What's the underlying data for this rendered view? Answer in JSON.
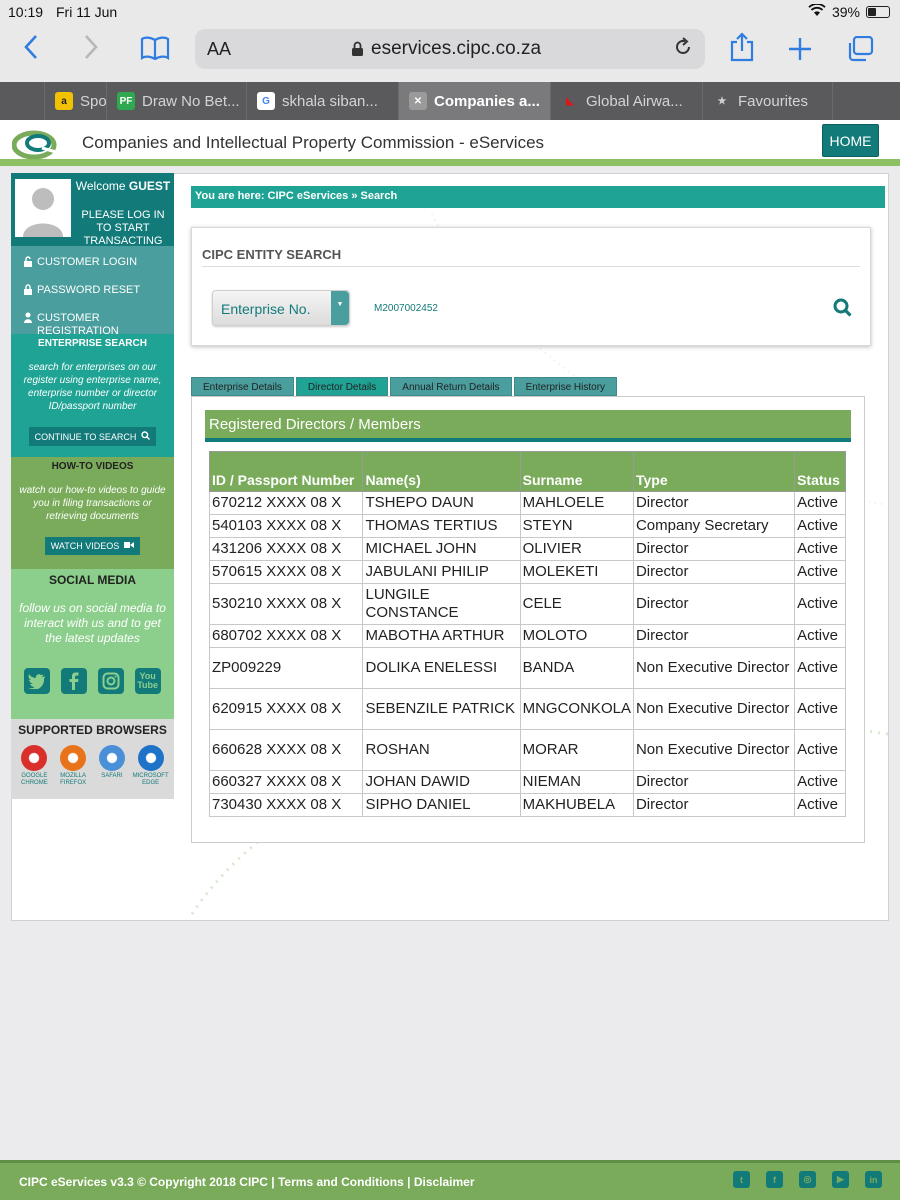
{
  "status": {
    "time": "10:19",
    "date": "Fri 11 Jun",
    "battery": "39%"
  },
  "browser": {
    "aa": "AA",
    "url": "eservices.cipc.co.za",
    "tabs": [
      {
        "label": "Spo",
        "fav": "a",
        "fav_bg": "#f2c200",
        "fav_fg": "#222"
      },
      {
        "label": "Draw No Bet...",
        "fav": "PF",
        "fav_bg": "#2fa84f",
        "fav_fg": "#fff"
      },
      {
        "label": "skhala siban...",
        "fav": "G",
        "fav_bg": "#ffffff",
        "fav_fg": "#4285f4"
      },
      {
        "label": "Companies a...",
        "fav": "✕",
        "fav_bg": "#9a9a9a",
        "fav_fg": "#fff",
        "active": true
      },
      {
        "label": "Global Airwa...",
        "fav": "◣",
        "fav_bg": "transparent",
        "fav_fg": "#d7191c"
      },
      {
        "label": "Favourites",
        "fav": "★",
        "fav_bg": "transparent",
        "fav_fg": "#cfcfcf"
      }
    ]
  },
  "header": {
    "title": "Companies and Intellectual Property Commission - eServices",
    "home": "HOME"
  },
  "sidebar": {
    "welcome": "Welcome",
    "user": "GUEST",
    "login_msg": "PLEASE LOG IN TO START TRANSACTING",
    "menu": [
      "CUSTOMER LOGIN",
      "PASSWORD RESET",
      "CUSTOMER REGISTRATION"
    ],
    "enterprise_title": "ENTERPRISE SEARCH",
    "enterprise_text": "search for enterprises on our register using enterprise name, enterprise number or director ID/passport number",
    "enterprise_btn": "CONTINUE TO SEARCH",
    "howto_title": "HOW-TO VIDEOS",
    "howto_text": "watch our how-to videos to guide you in filing transactions or retrieving documents",
    "howto_btn": "WATCH VIDEOS",
    "social_title": "SOCIAL MEDIA",
    "social_text": "follow us on social media to interact with us and to get the latest updates",
    "browsers_title": "SUPPORTED BROWSERS",
    "browsers": [
      {
        "label": "GOOGLE CHROME",
        "color": "#d9302b"
      },
      {
        "label": "MOZILLA FIREFOX",
        "color": "#e8731a"
      },
      {
        "label": "SAFARI",
        "color": "#4a90d9"
      },
      {
        "label": "MICROSOFT EDGE",
        "color": "#1e73c8"
      }
    ]
  },
  "breadcrumb": "You are here: CIPC eServices » Search",
  "search": {
    "title": "CIPC ENTITY SEARCH",
    "type": "Enterprise No.",
    "value": "M2007002452"
  },
  "content_tabs": [
    "Enterprise Details",
    "Director Details",
    "Annual Return Details",
    "Enterprise History"
  ],
  "active_tab": 1,
  "registered_title": "Registered Directors / Members",
  "table": {
    "headers": [
      "ID / Passport Number",
      "Name(s)",
      "Surname",
      "Type",
      "Status"
    ],
    "rows": [
      [
        "670212 XXXX 08 X",
        "TSHEPO DAUN",
        "MAHLOELE",
        "Director",
        "Active"
      ],
      [
        "540103 XXXX 08 X",
        "THOMAS TERTIUS",
        "STEYN",
        "Company Secretary",
        "Active"
      ],
      [
        "431206 XXXX 08 X",
        "MICHAEL JOHN",
        "OLIVIER",
        "Director",
        "Active"
      ],
      [
        "570615 XXXX 08 X",
        "JABULANI PHILIP",
        "MOLEKETI",
        "Director",
        "Active"
      ],
      [
        "530210 XXXX 08 X",
        "LUNGILE CONSTANCE",
        "CELE",
        "Director",
        "Active"
      ],
      [
        "680702 XXXX 08 X",
        "MABOTHA ARTHUR",
        "MOLOTO",
        "Director",
        "Active"
      ],
      [
        "ZP009229",
        "DOLIKA ENELESSI",
        "BANDA",
        "Non Executive Director",
        "Active"
      ],
      [
        "620915 XXXX 08 X",
        "SEBENZILE PATRICK",
        "MNGCONKOLA",
        "Non Executive Director",
        "Active"
      ],
      [
        "660628 XXXX 08 X",
        "ROSHAN",
        "MORAR",
        "Non Executive Director",
        "Active"
      ],
      [
        "660327 XXXX 08 X",
        "JOHAN DAWID",
        "NIEMAN",
        "Director",
        "Active"
      ],
      [
        "730430 XXXX 08 X",
        "SIPHO DANIEL",
        "MAKHUBELA",
        "Director",
        "Active"
      ]
    ]
  },
  "footer": {
    "copyright": "CIPC eServices v3.3 © Copyright 2018 CIPC",
    "terms": "Terms and Conditions",
    "disclaimer": "Disclaimer"
  }
}
